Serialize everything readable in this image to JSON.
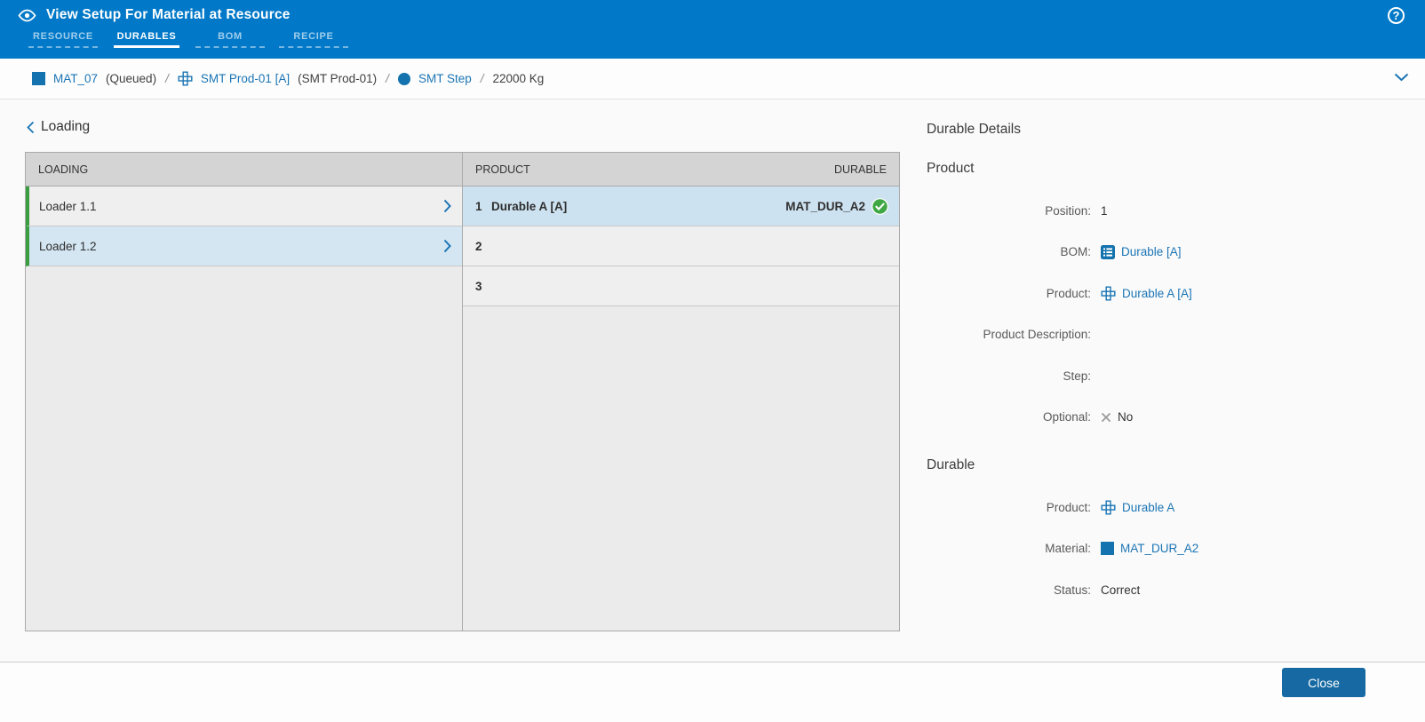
{
  "header": {
    "title": "View Setup For Material at Resource",
    "tabs": [
      {
        "label": "RESOURCE",
        "active": false
      },
      {
        "label": "DURABLES",
        "active": true
      },
      {
        "label": "BOM",
        "active": false
      },
      {
        "label": "RECIPE",
        "active": false
      }
    ],
    "help_glyph": "?"
  },
  "breadcrumb": {
    "material": "MAT_07",
    "material_state": "(Queued)",
    "separator": "/",
    "product": "SMT Prod-01 [A]",
    "product_description": "(SMT Prod-01)",
    "step": "SMT Step",
    "quantity": "22000 Kg"
  },
  "loading_section": {
    "title": "Loading",
    "loading_table": {
      "header": "LOADING",
      "rows": [
        {
          "label": "Loader 1.1",
          "selected": false
        },
        {
          "label": "Loader 1.2",
          "selected": true
        }
      ]
    },
    "product_table": {
      "header_product": "PRODUCT",
      "header_durable": "DURABLE",
      "rows": [
        {
          "position": "1",
          "product": "Durable A [A]",
          "durable": "MAT_DUR_A2",
          "status": "correct",
          "selected": true
        },
        {
          "position": "2",
          "product": "",
          "durable": "",
          "selected": false
        },
        {
          "position": "3",
          "product": "",
          "durable": "",
          "selected": false
        }
      ]
    }
  },
  "details": {
    "title": "Durable Details",
    "product_section": {
      "title": "Product",
      "position": {
        "label": "Position:",
        "value": "1"
      },
      "bom": {
        "label": "BOM:",
        "value": "Durable [A]"
      },
      "product": {
        "label": "Product:",
        "value": "Durable A [A]"
      },
      "description": {
        "label": "Product Description:",
        "value": ""
      },
      "step": {
        "label": "Step:",
        "value": ""
      },
      "optional": {
        "label": "Optional:",
        "value": "No"
      }
    },
    "durable_section": {
      "title": "Durable",
      "product": {
        "label": "Product:",
        "value": "Durable A"
      },
      "material": {
        "label": "Material:",
        "value": "MAT_DUR_A2"
      },
      "status": {
        "label": "Status:",
        "value": "Correct"
      }
    }
  },
  "footer": {
    "close_label": "Close"
  },
  "colors": {
    "header_blue": "#0279c8",
    "link_blue": "#1b75b5",
    "button_blue": "#1669a2",
    "selected_row_blue": "#d3e6f2",
    "success_green": "#3fa845",
    "loaded_row_green": "#3a9e41"
  },
  "icons": {
    "eye": "view-eye-icon",
    "help": "help-icon",
    "material": "material-square-icon",
    "product": "product-grid-icon",
    "step": "step-circle-icon",
    "bom": "bom-list-icon",
    "check": "check-circle-icon",
    "cross": "x-icon"
  }
}
